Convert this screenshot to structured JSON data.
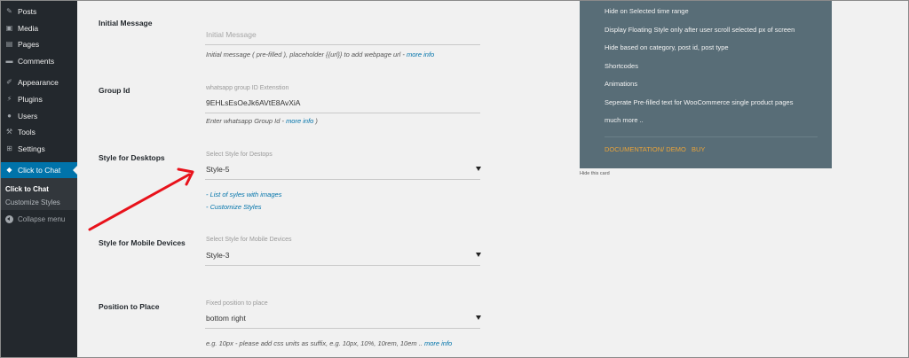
{
  "sidebar": {
    "items": [
      {
        "label": "Posts",
        "icon": "pin-icon"
      },
      {
        "label": "Media",
        "icon": "media-icon"
      },
      {
        "label": "Pages",
        "icon": "pages-icon"
      },
      {
        "label": "Comments",
        "icon": "comments-icon"
      },
      {
        "label": "Appearance",
        "icon": "brush-icon"
      },
      {
        "label": "Plugins",
        "icon": "plugin-icon"
      },
      {
        "label": "Users",
        "icon": "user-icon"
      },
      {
        "label": "Tools",
        "icon": "wrench-icon"
      },
      {
        "label": "Settings",
        "icon": "settings-icon"
      },
      {
        "label": "Click to Chat",
        "icon": "chat-icon"
      }
    ],
    "submenu": [
      "Click to Chat",
      "Customize Styles"
    ],
    "collapse_label": "Collapse menu",
    "accent_color": "#0073aa"
  },
  "form": {
    "initial_message": {
      "label": "Initial Message",
      "placeholder": "Initial Message",
      "help_prefix": "Initial message ( pre-filled ), placeholder {{url}} to add webpage url - ",
      "help_link": "more info"
    },
    "group_id": {
      "label": "Group Id",
      "caption": "whatsapp group ID Extenstion",
      "value": "9EHLsEsOeJk6AVtE8AvXiA",
      "help_prefix": "Enter whatsapp Group Id - ",
      "help_link": "more info",
      "help_suffix": " )"
    },
    "style_desktop": {
      "label": "Style for Desktops",
      "caption": "Select Style for Destops",
      "value": "Style-5",
      "link1": "- List of syles with images",
      "link2": "- Customize Styles"
    },
    "style_mobile": {
      "label": "Style for Mobile Devices",
      "caption": "Select Style for Mobile Devices",
      "value": "Style-3"
    },
    "position": {
      "label": "Position to Place",
      "caption": "Fixed position to place",
      "value": "bottom right",
      "help_prefix": "e.g. 10px - please add css units as suffix, e.g. 10px, 10%, 10rem, 10em .. ",
      "help_link": "more info"
    }
  },
  "card": {
    "items": [
      "Hide on Selected time range",
      "Display Floating Style only after user scroll selected px of screen",
      "Hide based on category, post id, post type",
      "Shortcodes",
      "Animations",
      "Seperate Pre-filled text for WooCommerce single product pages",
      "much more .."
    ],
    "documentation_link": "DOCUMENTATION/ DEMO",
    "buy_link": "BUY",
    "hide_label": "Hide this card",
    "background_color": "#586d77",
    "link_color": "#e8a33a"
  },
  "annotation": {
    "arrow_color": "#e8121b"
  }
}
